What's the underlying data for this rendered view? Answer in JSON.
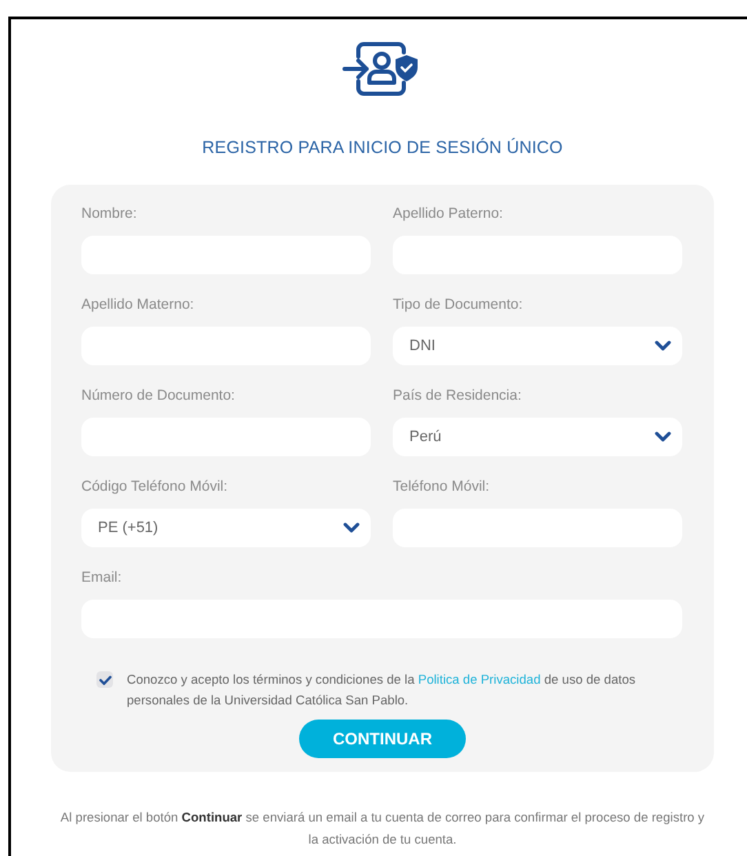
{
  "title": "REGISTRO PARA INICIO DE SESIÓN ÚNICO",
  "fields": [
    {
      "kind": "text",
      "label": "Nombre:",
      "wide": false
    },
    {
      "kind": "text",
      "label": "Apellido Paterno:",
      "wide": false
    },
    {
      "kind": "text",
      "label": "Apellido Materno:",
      "wide": false
    },
    {
      "kind": "select",
      "label": "Tipo de Documento:",
      "value": "DNI",
      "wide": false
    },
    {
      "kind": "text",
      "label": "Número de Documento:",
      "wide": false
    },
    {
      "kind": "select",
      "label": "País de Residencia:",
      "value": "Perú",
      "wide": false
    },
    {
      "kind": "select",
      "label": "Código Teléfono Móvil:",
      "value": "PE (+51)",
      "wide": false
    },
    {
      "kind": "text",
      "label": "Teléfono Móvil:",
      "wide": false
    },
    {
      "kind": "text",
      "label": "Email:",
      "wide": true
    }
  ],
  "consent": {
    "checked": true,
    "before": "Conozco y acepto los términos y condiciones de la",
    "link": "Politica de Privacidad",
    "after": "de uso de datos personales de la Universidad Católica San Pablo."
  },
  "button": "CONTINUAR",
  "footnote": "Al presionar el botón **Continuar** se enviará un email a tu cuenta de correo para confirmar el proceso de registro y la activación de tu cuenta."
}
